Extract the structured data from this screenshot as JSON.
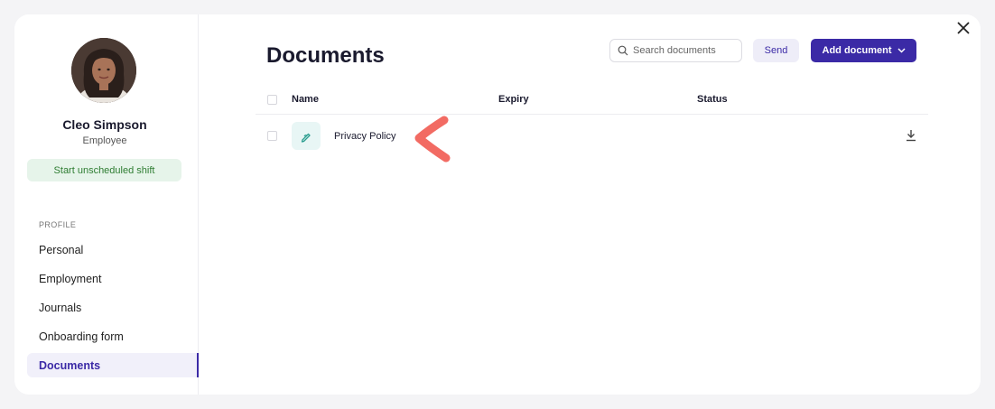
{
  "user": {
    "name": "Cleo Simpson",
    "role": "Employee"
  },
  "shift_button": "Start unscheduled shift",
  "profile": {
    "section_label": "PROFILE",
    "items": [
      {
        "label": "Personal"
      },
      {
        "label": "Employment"
      },
      {
        "label": "Journals"
      },
      {
        "label": "Onboarding form"
      },
      {
        "label": "Documents"
      }
    ],
    "active": "Documents"
  },
  "main": {
    "title": "Documents",
    "search": {
      "placeholder": "Search documents",
      "value": ""
    },
    "send_label": "Send",
    "add_label": "Add document"
  },
  "table": {
    "columns": [
      "Name",
      "Expiry",
      "Status"
    ],
    "rows": [
      {
        "name": "Privacy Policy",
        "expiry": "",
        "status": ""
      }
    ]
  },
  "colors": {
    "accent": "#3b2aa6",
    "shift_bg": "#e6f4ea",
    "shift_text": "#2e7d32",
    "annotation_arrow": "#f26b63"
  },
  "icons": [
    "search-icon",
    "chevron-down-icon",
    "close-icon",
    "document-pen-icon",
    "download-icon",
    "annotation-arrow-icon"
  ]
}
